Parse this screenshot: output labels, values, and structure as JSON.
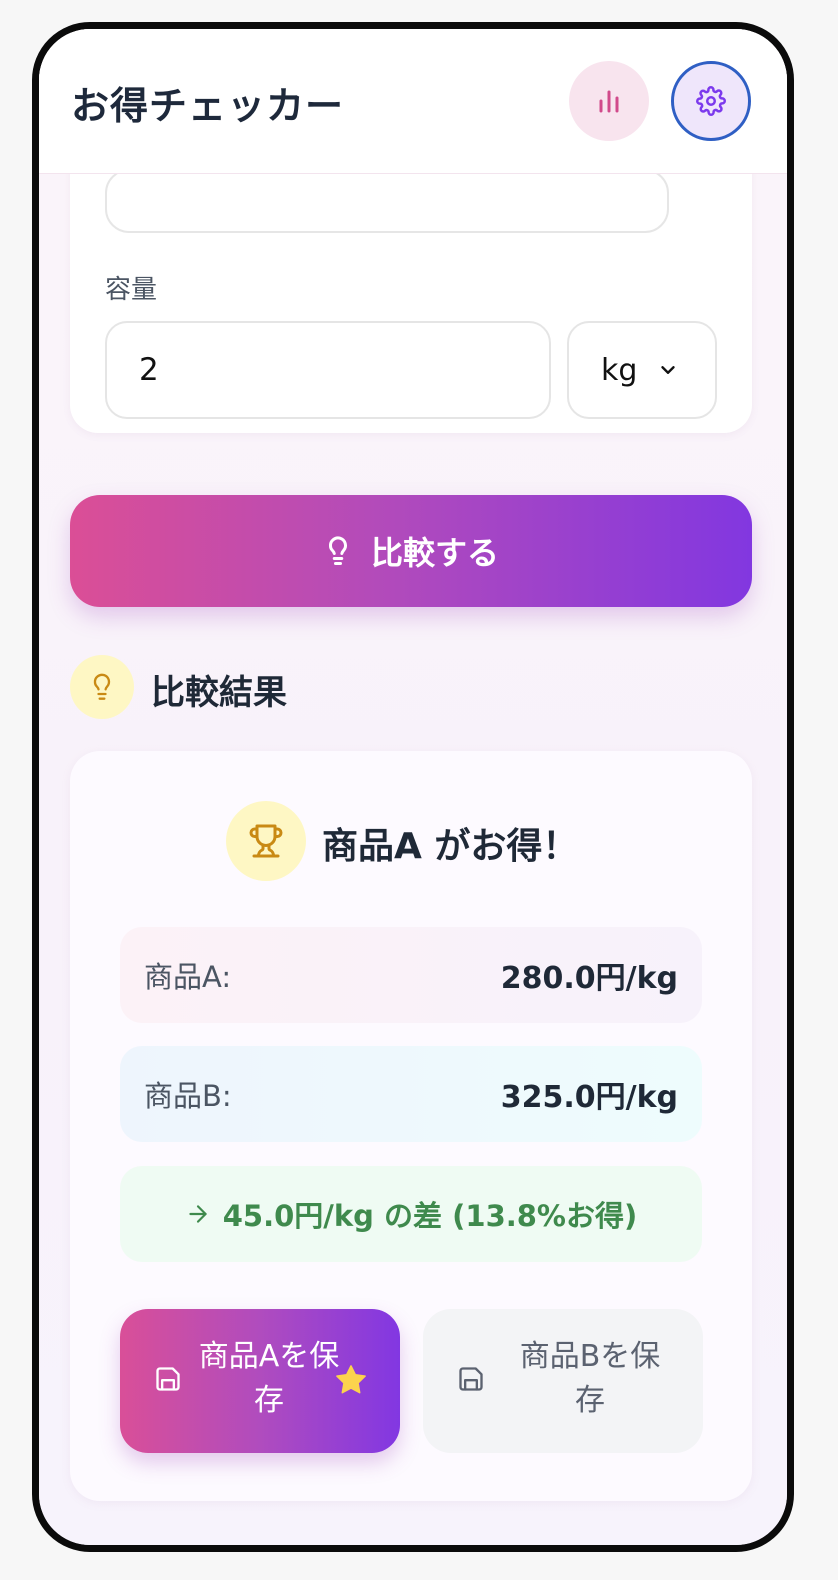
{
  "header": {
    "title": "お得チェッカー",
    "stats_icon": "bar-chart-icon",
    "settings_icon": "gear-icon"
  },
  "form": {
    "capacity_label": "容量",
    "capacity_value": "2",
    "unit_selected": "kg"
  },
  "compare_button": {
    "label": "比較する",
    "icon": "lightbulb-icon"
  },
  "results": {
    "title": "比較結果",
    "winner": "商品A がお得！",
    "product_a_label": "商品A:",
    "product_a_value": "280.0円/kg",
    "product_b_label": "商品B:",
    "product_b_value": "325.0円/kg",
    "difference": "45.0円/kg の差 (13.8%お得)",
    "save_a_label": "商品Aを保存",
    "save_b_label": "商品Bを保存"
  },
  "colors": {
    "accent_pink": "#db4e96",
    "accent_purple": "#8237e0",
    "success_green": "#3f8a4d",
    "highlight_yellow": "#fef7c4"
  }
}
